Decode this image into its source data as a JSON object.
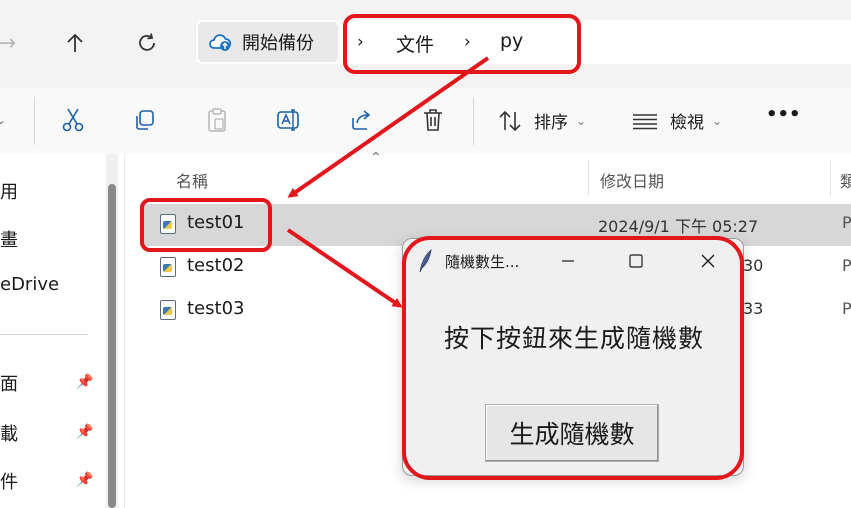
{
  "address_bar": {
    "backup_label": "開始備份",
    "breadcrumb": [
      "文件",
      "py"
    ],
    "separator": "›"
  },
  "toolbar": {
    "sort_label": "排序",
    "view_label": "檢視",
    "more_label": "•••"
  },
  "sidebar": {
    "items": [
      {
        "label": "用",
        "pinned": false
      },
      {
        "label": "畫",
        "pinned": false
      },
      {
        "label": "eDrive",
        "pinned": false
      },
      {
        "label": "面",
        "pinned": true
      },
      {
        "label": "載",
        "pinned": true
      },
      {
        "label": "件",
        "pinned": true
      }
    ]
  },
  "file_list": {
    "columns": [
      "名稱",
      "修改日期",
      "類"
    ],
    "rows": [
      {
        "name": "test01",
        "date": "2024/9/1 下午 05:27",
        "type": "P",
        "selected": true
      },
      {
        "name": "test02",
        "date": "30",
        "type": "P",
        "selected": false
      },
      {
        "name": "test03",
        "date": "33",
        "type": "P",
        "selected": false
      }
    ]
  },
  "tk_window": {
    "title": "隨機數生...",
    "label": "按下按鈕來生成隨機數",
    "button": "生成隨機數"
  },
  "colors": {
    "annotation_red": "#e3161b",
    "selection": "#d7d7d7",
    "accent": "#1a73c8"
  }
}
